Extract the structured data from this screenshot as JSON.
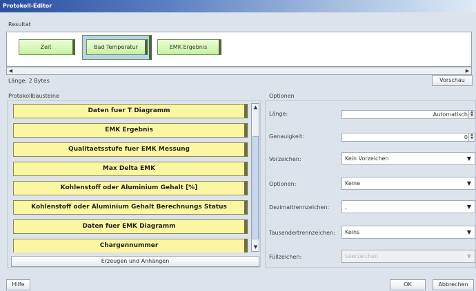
{
  "window": {
    "title": "Protokoll-Editor"
  },
  "result": {
    "label": "Resultat",
    "tokens": [
      {
        "label": "Zeit"
      },
      {
        "label": "Bad Temperatur"
      },
      {
        "label": "EMK Ergebnis"
      }
    ],
    "length_text": "Länge: 2 Bytes",
    "preview_button": "Vorschau"
  },
  "palette": {
    "label": "Protokollbausteine",
    "items": [
      {
        "label": "Daten fuer T Diagramm"
      },
      {
        "label": "EMK Ergebnis"
      },
      {
        "label": "Qualitaetsstufe fuer EMK Messung"
      },
      {
        "label": "Max Delta EMK"
      },
      {
        "label": "Kohlenstoff oder Aluminium Gehalt [%]"
      },
      {
        "label": "Kohlenstoff oder Aluminium Gehalt Berechnungs Status"
      },
      {
        "label": "Daten fuer EMK Diagramm"
      },
      {
        "label": "Chargennummer"
      }
    ],
    "generate_button": "Erzeugen und Anhängen"
  },
  "options": {
    "label": "Optionen",
    "length": {
      "label": "Länge:",
      "value": "Automatisch"
    },
    "precision": {
      "label": "Genauigkeit:",
      "value": "0"
    },
    "sign": {
      "label": "Vorzeichen:",
      "value": "Kein Vorzeichen"
    },
    "options_field": {
      "label": "Optionen:",
      "value": "Keine"
    },
    "decimal_sep": {
      "label": "Dezimaltrennzeichen:",
      "value": ","
    },
    "thousands_sep": {
      "label": "Tausendertrennzeichen:",
      "value": "Keins"
    },
    "fill_char": {
      "label": "Füllzeichen:",
      "value": "Leerzeichen"
    }
  },
  "footer": {
    "help": "Hilfe",
    "ok": "OK",
    "cancel": "Abbrechen"
  },
  "icons": {
    "scroll_left": "arrow-left-icon",
    "scroll_right": "arrow-right-icon",
    "scroll_up": "arrow-up-icon",
    "scroll_down": "arrow-down-icon",
    "dropdown": "chevron-down-icon"
  }
}
